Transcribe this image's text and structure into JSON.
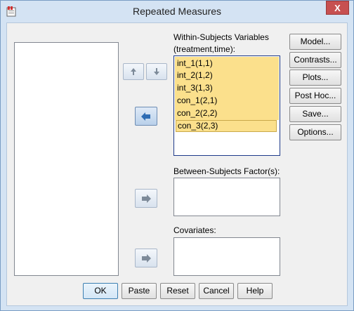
{
  "window": {
    "title": "Repeated Measures",
    "close_glyph": "X"
  },
  "within": {
    "label_line1": "Within-Subjects Variables",
    "label_line2": "(treatment,time):",
    "items": [
      "int_1(1,1)",
      "int_2(1,2)",
      "int_3(1,3)",
      "con_1(2,1)",
      "con_2(2,2)",
      "con_3(2,3)"
    ]
  },
  "between": {
    "label": "Between-Subjects Factor(s):"
  },
  "covariates": {
    "label": "Covariates:"
  },
  "side_buttons": {
    "model": "Model...",
    "contrasts": "Contrasts...",
    "plots": "Plots...",
    "posthoc": "Post Hoc...",
    "save": "Save...",
    "options": "Options..."
  },
  "bottom_buttons": {
    "ok": "OK",
    "paste": "Paste",
    "reset": "Reset",
    "cancel": "Cancel",
    "help": "Help"
  },
  "colors": {
    "selection": "#fbe08c",
    "accent_arrow": "#2e6db4"
  }
}
